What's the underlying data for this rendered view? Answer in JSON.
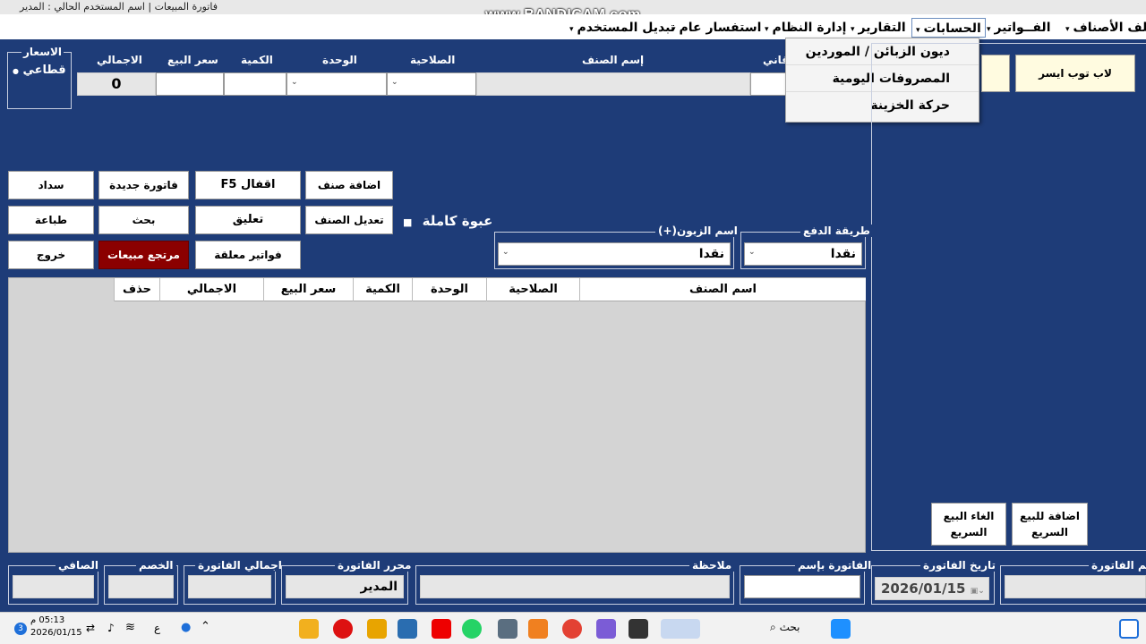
{
  "window": {
    "title": "فاتورة المبيعات | اسم المستخدم الحالي : المدير",
    "watermark": "www.BANDICAM.com"
  },
  "menu": {
    "items": [
      {
        "label": "ملف الأصناف"
      },
      {
        "label": "الفــواتير"
      },
      {
        "label": "الحسابات"
      },
      {
        "label": "التقارير"
      },
      {
        "label": "إدارة النظام"
      },
      {
        "label": "استفسار عام"
      },
      {
        "label": "تبديل المستخدم"
      }
    ]
  },
  "accounts_dropdown": {
    "items": [
      "ديون الزبائن / الموردين",
      "المصروفات اليومية",
      "حركة الخزينة"
    ]
  },
  "prices": {
    "title": "الاسعار",
    "option_label": "قطاعي"
  },
  "entry": {
    "total_label": "الاجمالي",
    "total_value": "0",
    "sale_price_label": "سعر البيع",
    "quantity_label": "الكمية",
    "unit_label": "الوحدة",
    "validity_label": "الصلاحية",
    "item_name_label": "إسم الصنف",
    "barcode_label_partial": "قاني"
  },
  "buttons": {
    "pay": "سداد",
    "new_invoice": "فاتورة جديدة",
    "close_f5": "اقفال F5",
    "add_item": "اضافة صنف",
    "print": "طباعة",
    "search": "بحث",
    "suspend": "تعليق",
    "edit_item": "تعديل الصنف",
    "exit": "خروج",
    "sales_return": "مرتجع مبيعات",
    "suspended_invoices": "فواتير معلقة",
    "laptop": "لاب توب ايسر",
    "quick_add_1": "اضافة للبيع",
    "quick_add_2": "السريع",
    "quick_cancel_1": "الغاء البيع",
    "quick_cancel_2": "السريع"
  },
  "full_pack": {
    "label": "عبوة كاملة"
  },
  "customer": {
    "label": "اسم الزبون(+)",
    "value": "نقدا"
  },
  "payment": {
    "label": "طريقة الدفع",
    "value": "نقدا"
  },
  "grid": {
    "columns": [
      "اسم الصنف",
      "الصلاحية",
      "الوحدة",
      "الكمية",
      "سعر البيع",
      "الاجمالي",
      "حذف"
    ]
  },
  "footer": {
    "net_label": "الصافي",
    "discount_label": "الخصم",
    "invoice_total_label": "اجمالي الفاتورة",
    "invoice_editor_label": "محرر الفاتورة",
    "invoice_editor_value": "المدير",
    "note_label": "ملاحظة",
    "invoice_name_label": "الفاتورة بإسم",
    "invoice_date_label": "تاريخ الفاتورة",
    "invoice_date_value": "2026/01/15",
    "invoice_number_label": "رقم الفاتورة"
  },
  "taskbar": {
    "time": "05:13 م",
    "date": "2026/01/15",
    "search_label": "بحث",
    "keyboard_lang": "ع",
    "notif_count": "3"
  }
}
